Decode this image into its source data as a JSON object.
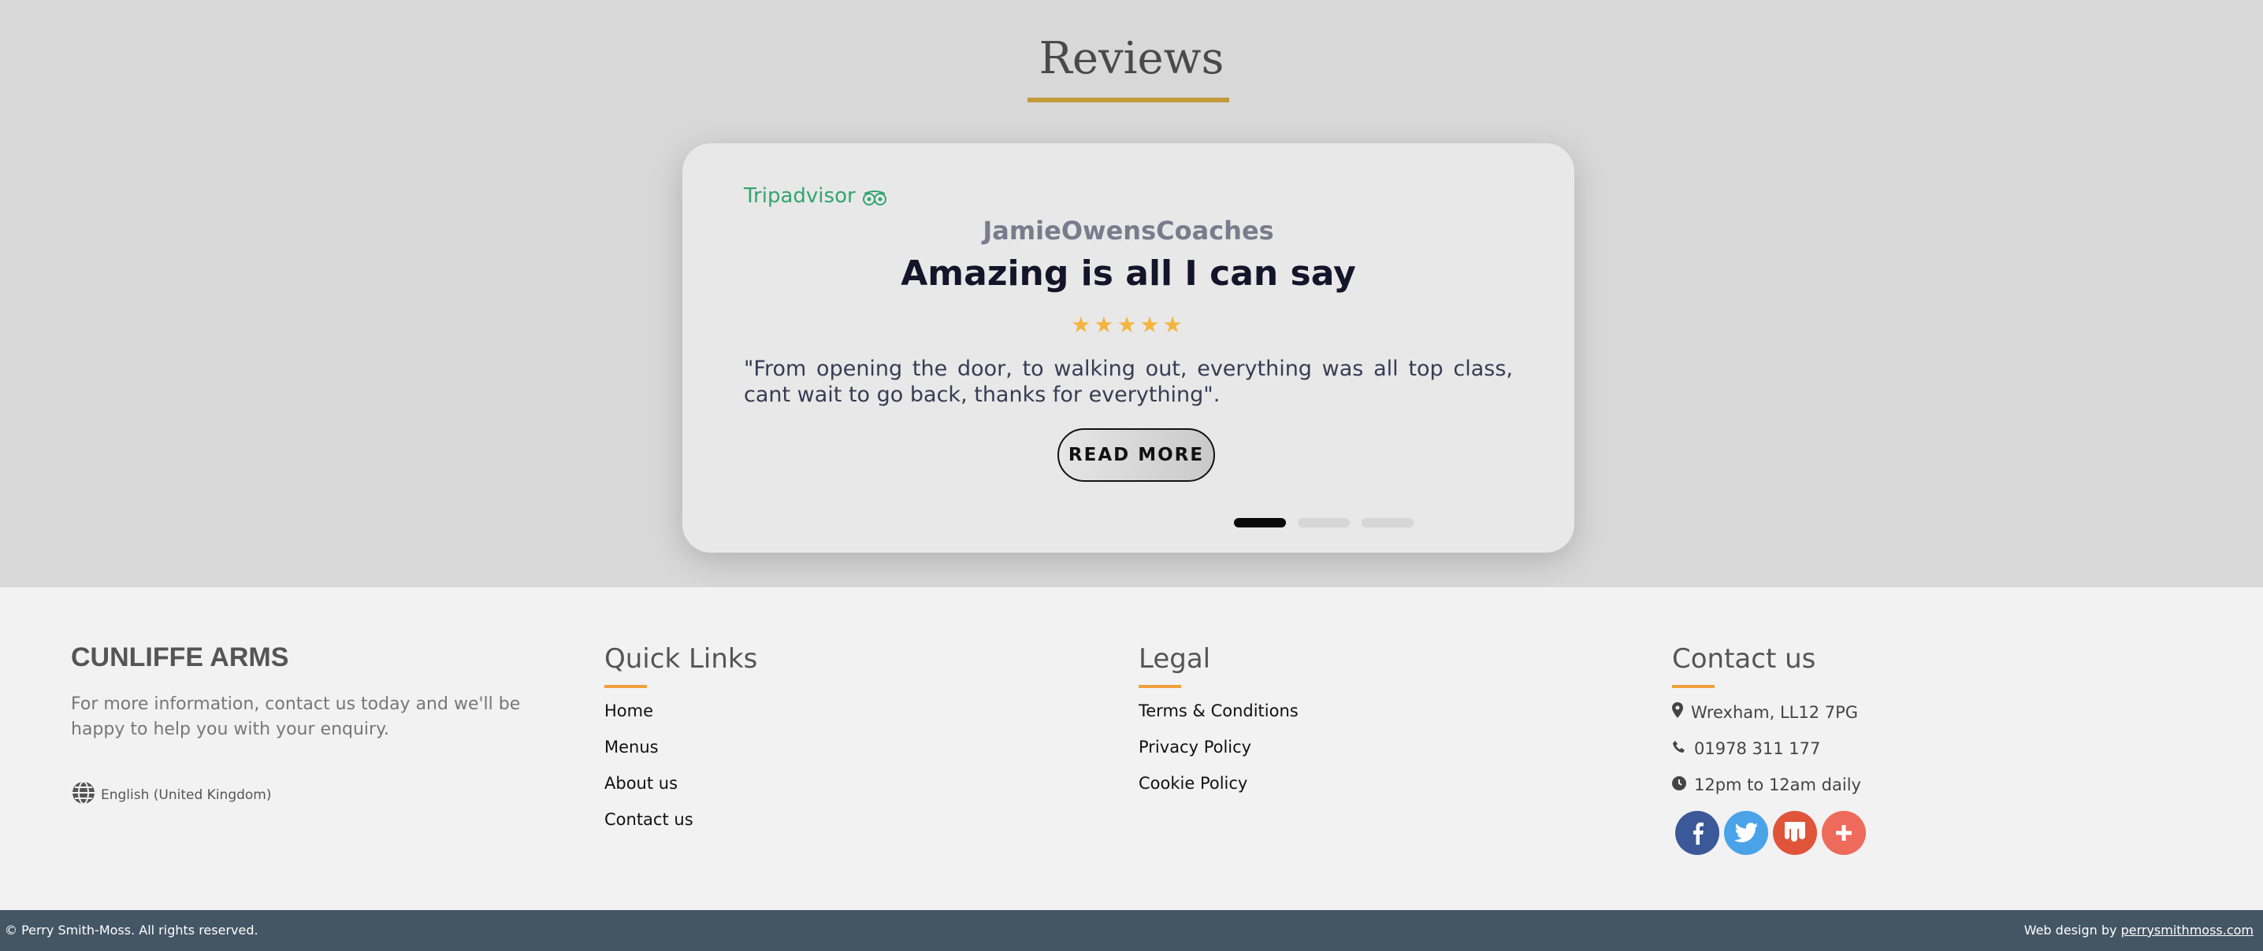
{
  "reviews": {
    "heading": "Reviews",
    "source": "Tripadvisor",
    "author": "JamieOwensCoaches",
    "title": "Amazing is all I can say",
    "rating": 5,
    "stars": "★★★★★",
    "text": "\"From opening the door, to walking out, everything was all top class, cant wait to go back, thanks for everything\".",
    "read_more": "READ MORE",
    "slides": 3,
    "active_slide": 1
  },
  "footer": {
    "brand": "CUNLIFFE ARMS",
    "description": "For more information, contact us today and we'll be happy to help you with your enquiry.",
    "language": "English (United Kingdom)",
    "quick_links": {
      "heading": "Quick Links",
      "items": [
        "Home",
        "Menus",
        "About us",
        "Contact us"
      ]
    },
    "legal": {
      "heading": "Legal",
      "items": [
        "Terms & Conditions",
        "Privacy Policy",
        "Cookie Policy"
      ]
    },
    "contact": {
      "heading": "Contact us",
      "address": "Wrexham, LL12 7PG",
      "phone": "01978 311 177",
      "hours": "12pm to 12am daily"
    },
    "social": [
      {
        "name": "facebook-icon",
        "color": "#3b5998"
      },
      {
        "name": "twitter-icon",
        "color": "#4aa3e8"
      },
      {
        "name": "mix-icon",
        "color": "#e0543a"
      },
      {
        "name": "plus-icon",
        "color": "#ee6a5a"
      }
    ]
  },
  "bottom_bar": {
    "copyright": "© Perry Smith-Moss. All rights reserved.",
    "credit_prefix": "Web design by",
    "credit_link": "perrysmithmoss.com"
  },
  "colors": {
    "accent_gold": "#c29a3a",
    "accent_orange": "#f0a13a",
    "tripadvisor_green": "#34a46f",
    "star": "#f3b53d",
    "bottom_bar": "#445564"
  }
}
